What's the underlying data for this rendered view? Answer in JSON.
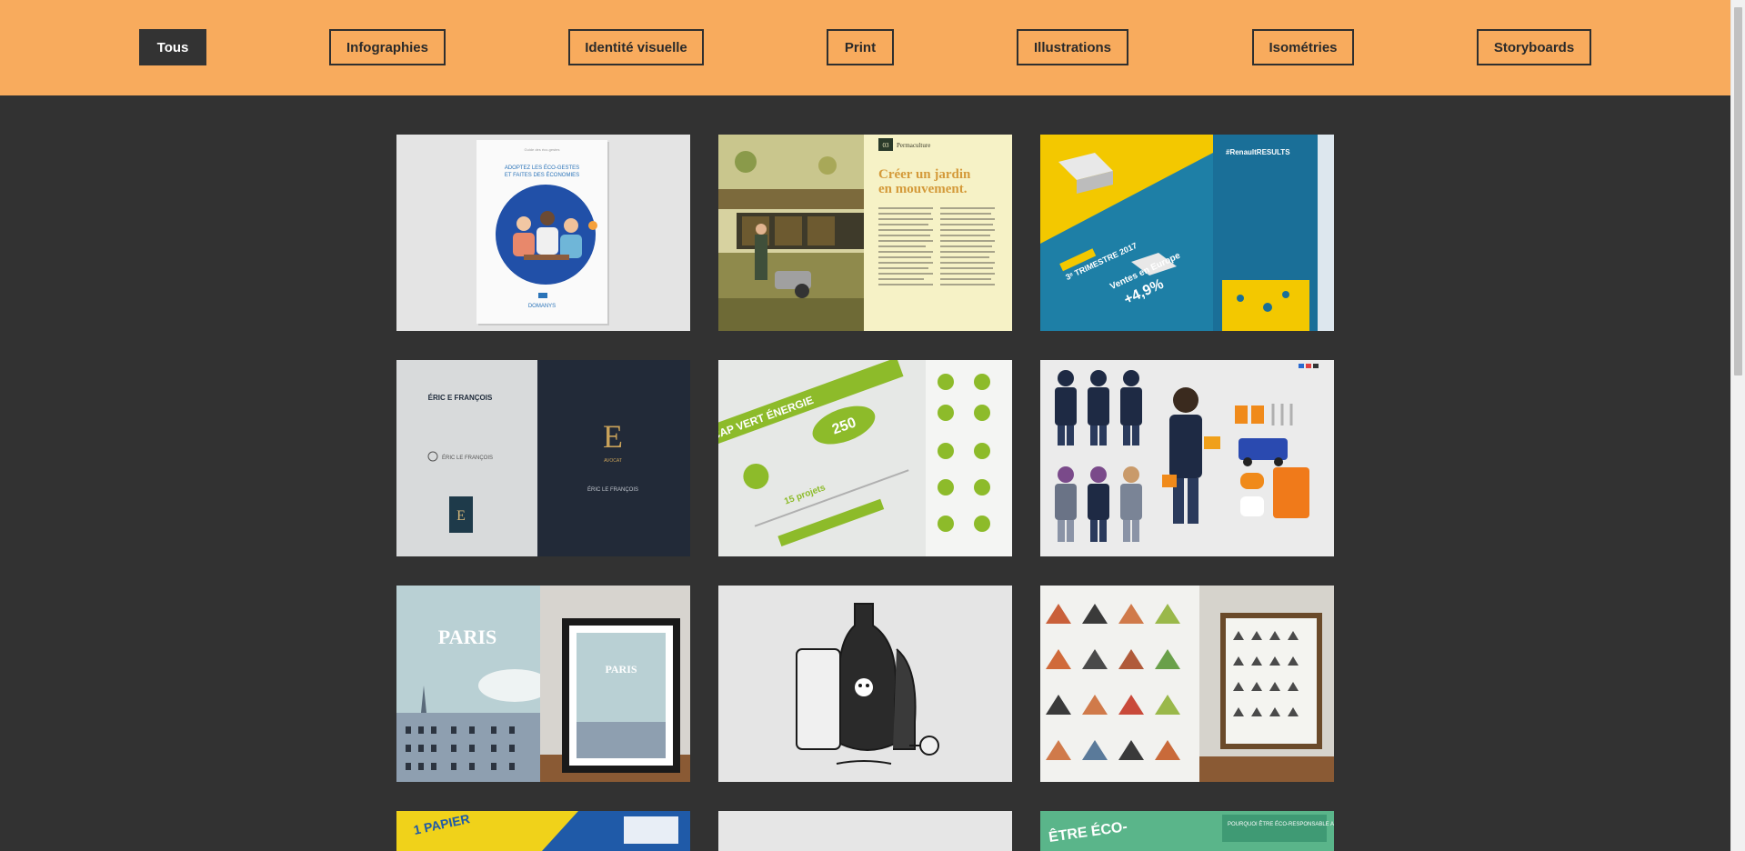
{
  "filters": [
    {
      "label": "Tous",
      "active": true
    },
    {
      "label": "Infographies",
      "active": false
    },
    {
      "label": "Identité visuelle",
      "active": false
    },
    {
      "label": "Print",
      "active": false
    },
    {
      "label": "Illustrations",
      "active": false
    },
    {
      "label": "Isométries",
      "active": false
    },
    {
      "label": "Storyboards",
      "active": false
    }
  ],
  "colors": {
    "header_bg": "#f8ab5d",
    "page_bg": "#323232",
    "active_filter_bg": "#333333"
  },
  "portfolio": {
    "card1": {
      "kicker": "Guide des éco-gestes",
      "title1": "ADOPTEZ LES ÉCO-GESTES",
      "title2": "ET FAITES DES ÉCONOMIES",
      "brand": "DOMANYS"
    },
    "card2": {
      "tag": "03",
      "section": "Permaculture",
      "headline1": "Créer un jardin",
      "headline2": "en mouvement."
    },
    "card3": {
      "brand": "#RenaultRESULTS",
      "period": "3ᵉ TRIMESTRE 2017",
      "headline": "Ventes en Europe",
      "value": "+4,9%"
    },
    "card4": {
      "name": "ÉRIC LE FRANÇOIS",
      "name_alt": "ÉRIC E FRANÇOIS",
      "role": "AVOCAT",
      "monogram": "E"
    },
    "card5": {
      "headline": "CAP VERT ÉNERGIE",
      "figure": "250",
      "projects": "15 projets"
    },
    "card7": {
      "city": "PARIS",
      "city_small": "PARIS"
    },
    "card11": {
      "headline": "ÊTRE ÉCO-",
      "subtitle": "POURQUOI ÊTRE ÉCO-RESPONSABLE AU BUREAU"
    },
    "card10": {
      "headline": "1 PAPIER"
    }
  }
}
